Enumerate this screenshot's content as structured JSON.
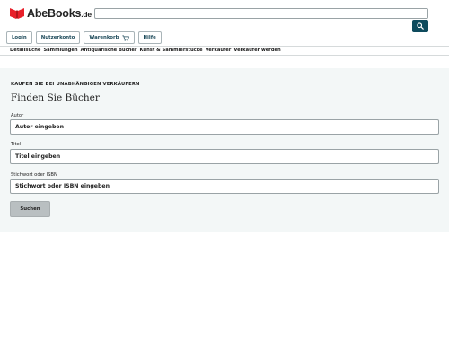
{
  "header": {
    "logo_text": "AbeBooks",
    "logo_tld": ".de",
    "search": {
      "value": "",
      "placeholder": ""
    },
    "search_button_icon": "search-icon"
  },
  "nav": {
    "login": "Login",
    "account": "Nutzerkonto",
    "cart": "Warenkorb",
    "cart_icon": "cart-icon",
    "help": "Hilfe"
  },
  "categories": [
    "Detailsuche",
    "Sammlungen",
    "Antiquarische Bücher",
    "Kunst & Sammlerstücke",
    "Verkäufer",
    "Verkäufer werden"
  ],
  "main": {
    "eyebrow": "KAUFEN SIE BEI UNABHÄNGIGEN VERKÄUFERN",
    "title": "Finden Sie Bücher",
    "fields": [
      {
        "label": "Autor",
        "placeholder": "Autor eingeben",
        "value": ""
      },
      {
        "label": "Titel",
        "placeholder": "Titel eingeben",
        "value": ""
      },
      {
        "label": "Stichwort oder ISBN",
        "placeholder": "Stichwort oder ISBN eingeben",
        "value": ""
      }
    ],
    "submit_label": "Suchen"
  },
  "colors": {
    "brand_red": "#e8202a",
    "accent_teal": "#0e4b5d",
    "panel_bg": "#f3f7f7",
    "button_gray": "#b9bfc1"
  }
}
